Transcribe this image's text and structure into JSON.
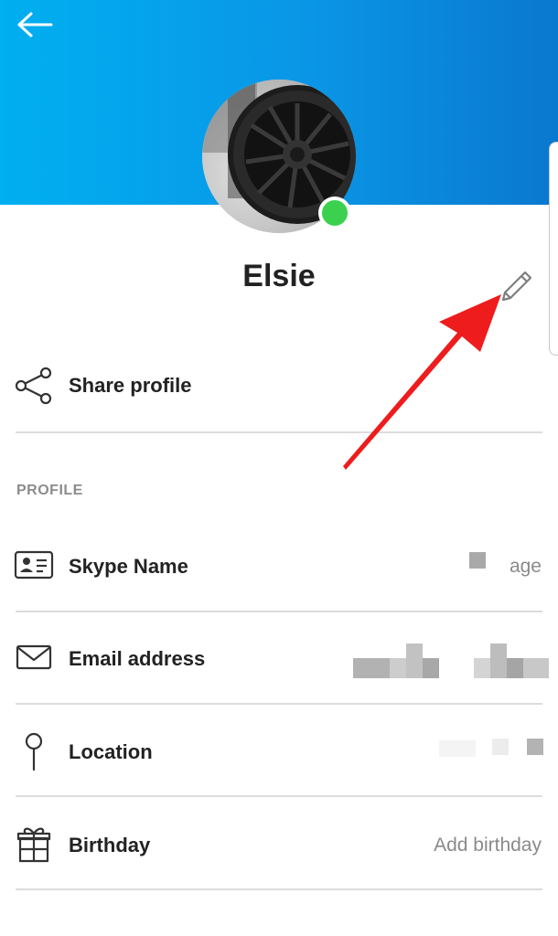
{
  "profile": {
    "display_name": "Elsie",
    "presence_color": "#3bd14f"
  },
  "share": {
    "label": "Share profile"
  },
  "section": {
    "title": "PROFILE"
  },
  "fields": [
    {
      "label": "Skype Name",
      "value": "age",
      "icon": "id-card-icon"
    },
    {
      "label": "Email address",
      "value": "",
      "icon": "envelope-icon"
    },
    {
      "label": "Location",
      "value": "",
      "icon": "location-pin-icon"
    },
    {
      "label": "Birthday",
      "value": "Add birthday",
      "icon": "gift-icon"
    }
  ],
  "colors": {
    "header_start": "#00aff0",
    "header_end": "#0a78cf",
    "annotation_arrow": "#ee1c1c"
  }
}
